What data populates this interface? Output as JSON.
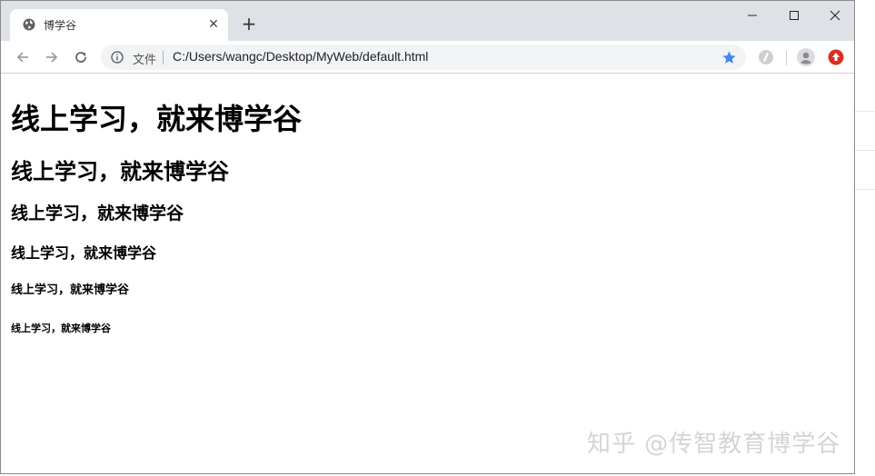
{
  "browser": {
    "tab": {
      "title": "博学谷",
      "close_symbol": "✕"
    },
    "new_tab_symbol": "+",
    "window_controls": [
      "minimize-icon",
      "maximize-icon",
      "close-icon"
    ],
    "omnibox": {
      "security_label": "文件",
      "url": "C:/Users/wangc/Desktop/MyWeb/default.html"
    },
    "accent_color": "#4285f4"
  },
  "page": {
    "headings": [
      "线上学习，就来博学谷",
      "线上学习，就来博学谷",
      "线上学习，就来博学谷",
      "线上学习，就来博学谷",
      "线上学习，就来博学谷",
      "线上学习，就来博学谷"
    ]
  },
  "watermark": "知乎 @传智教育博学谷"
}
